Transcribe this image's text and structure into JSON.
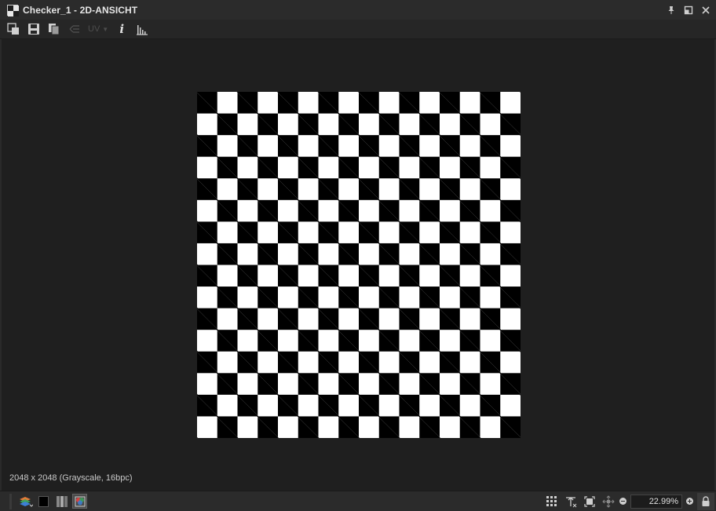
{
  "window": {
    "title": "Checker_1 - 2D-ANSICHT",
    "icon": "checker-thumbnail-icon",
    "actions": [
      "pin-icon",
      "maximize-icon",
      "close-icon"
    ]
  },
  "toolbar": {
    "items": [
      {
        "icon": "export-image-icon",
        "enabled": true
      },
      {
        "icon": "save-icon",
        "enabled": true
      },
      {
        "icon": "copy-icon",
        "enabled": true
      },
      {
        "icon": "uv-connections-icon",
        "enabled": false
      },
      {
        "icon": "uv-dropdown",
        "enabled": false
      },
      {
        "icon": "info-icon",
        "enabled": true
      },
      {
        "icon": "histogram-icon",
        "enabled": true
      }
    ],
    "uv_label": "UV",
    "info_label": "i"
  },
  "image": {
    "pattern": "checkerboard",
    "columns": 16,
    "rows": 16,
    "color_a": "#ffffff",
    "color_b": "#000000",
    "info": "2048 x 2048 (Grayscale, 16bpc)"
  },
  "statusbar": {
    "left_buttons": [
      "layers-icon",
      "color-swatch-black",
      "channels-icon",
      "material-preview-icon"
    ],
    "right_buttons": [
      "tile-grid-icon",
      "fit-width-icon",
      "fit-frame-icon",
      "pan-icon"
    ],
    "zoom_value": "22.99%",
    "lock_icon": "lock-icon"
  },
  "colors": {
    "background": "#1f1f1f",
    "titlebar": "#2b2b2b",
    "toolbar": "#262626",
    "statusbar": "#2b2b2b",
    "text": "#d8d8d8"
  }
}
